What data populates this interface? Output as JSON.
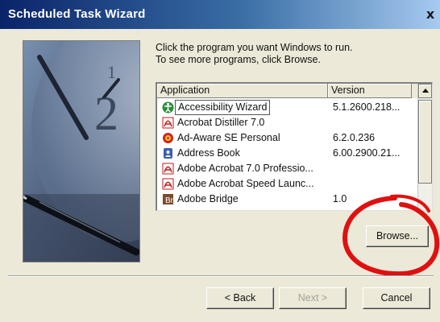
{
  "window": {
    "title": "Scheduled Task Wizard",
    "close_glyph": "x"
  },
  "instructions": {
    "line1": "Click the program you want Windows to run.",
    "line2": "To see more programs, click Browse."
  },
  "list": {
    "columns": [
      "Application",
      "Version"
    ],
    "rows": [
      {
        "name": "Accessibility Wizard",
        "version": "5.1.2600.218...",
        "icon": "accessibility-icon",
        "selected": true
      },
      {
        "name": "Acrobat Distiller 7.0",
        "version": "",
        "icon": "acrobat-icon"
      },
      {
        "name": "Ad-Aware SE Personal",
        "version": "6.2.0.236",
        "icon": "adaware-icon"
      },
      {
        "name": "Address Book",
        "version": "6.00.2900.21...",
        "icon": "address-book-icon"
      },
      {
        "name": "Adobe Acrobat 7.0 Professio...",
        "version": "",
        "icon": "acrobat-icon"
      },
      {
        "name": "Adobe Acrobat Speed Launc...",
        "version": "",
        "icon": "acrobat-icon"
      },
      {
        "name": "Adobe Bridge",
        "version": "1.0",
        "icon": "adobe-bridge-icon"
      }
    ]
  },
  "buttons": {
    "browse": "Browse...",
    "back": "< Back",
    "next": "Next >",
    "cancel": "Cancel"
  },
  "colors": {
    "titlebar_start": "#0a246a",
    "titlebar_end": "#a6caf0",
    "dialog_bg": "#ece9d8",
    "annotation_red": "#e01010"
  }
}
